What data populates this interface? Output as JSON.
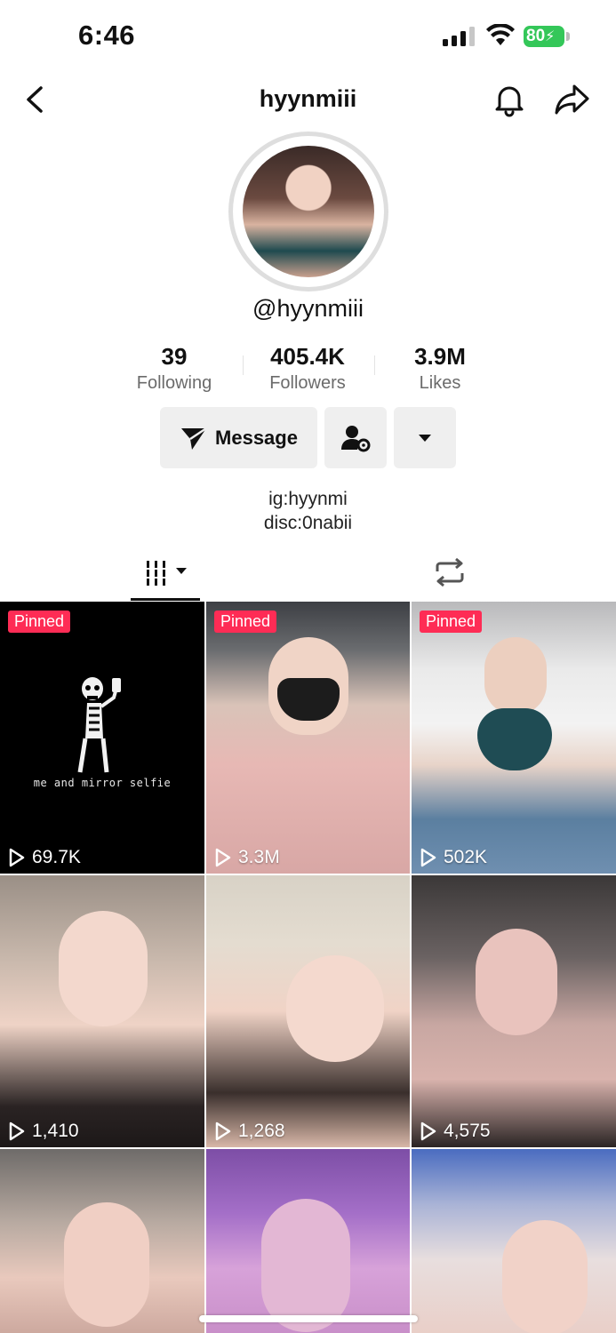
{
  "status": {
    "time": "6:46",
    "battery": "80"
  },
  "nav": {
    "title": "hyynmiii"
  },
  "profile": {
    "handle": "@hyynmiii",
    "stats": [
      {
        "value": "39",
        "label": "Following"
      },
      {
        "value": "405.4K",
        "label": "Followers"
      },
      {
        "value": "3.9M",
        "label": "Likes"
      }
    ],
    "message_label": "Message",
    "bio_line1": "ig:hyynmi",
    "bio_line2": "disc:0nabii"
  },
  "videos": [
    {
      "pinned": "Pinned",
      "views": "69.7K",
      "caption": "me and mirror selfie"
    },
    {
      "pinned": "Pinned",
      "views": "3.3M"
    },
    {
      "pinned": "Pinned",
      "views": "502K"
    },
    {
      "views": "1,410"
    },
    {
      "views": "1,268"
    },
    {
      "views": "4,575"
    },
    {},
    {},
    {}
  ],
  "colors": {
    "pinned_badge": "#fe2c55",
    "battery": "#34c759",
    "button_bg": "#efefef"
  }
}
